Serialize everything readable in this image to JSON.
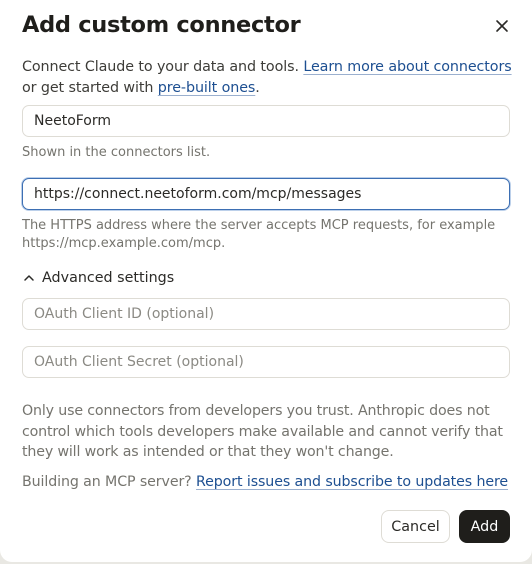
{
  "dialog": {
    "title": "Add custom connector",
    "close_icon": "close-icon",
    "intro": {
      "text_before": "Connect Claude to your data and tools. ",
      "learn_link": "Learn more about connectors",
      "text_middle": " or get started with ",
      "prebuilt_link": "pre-built ones",
      "text_after": "."
    },
    "name_field": {
      "value": "NeetoForm",
      "help": "Shown in the connectors list."
    },
    "url_field": {
      "value": "https://connect.neetoform.com/mcp/messages",
      "help": "The HTTPS address where the server accepts MCP requests, for example https://mcp.example.com/mcp."
    },
    "advanced": {
      "label": "Advanced settings",
      "icon": "chevron-up-icon",
      "client_id_placeholder": "OAuth Client ID (optional)",
      "client_secret_placeholder": "OAuth Client Secret (optional)"
    },
    "warning": "Only use connectors from developers you trust. Anthropic does not control which tools developers make available and cannot verify that they will work as intended or that they won't change.",
    "building": {
      "text": "Building an MCP server? ",
      "link": "Report issues and subscribe to updates here"
    },
    "buttons": {
      "cancel": "Cancel",
      "add": "Add"
    }
  }
}
